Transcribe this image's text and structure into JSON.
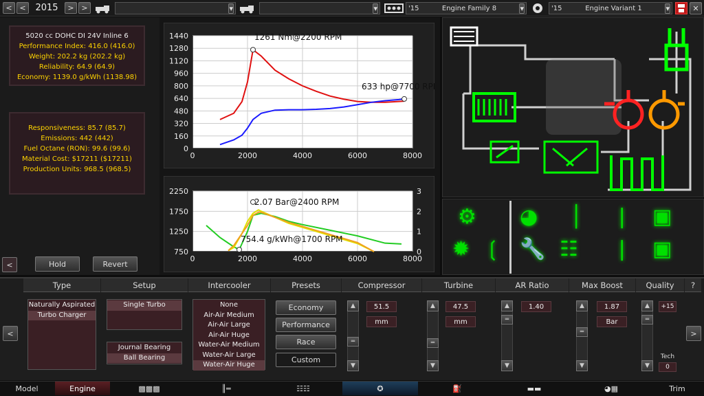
{
  "topbar": {
    "year": "2015",
    "family_year": "'15",
    "family_name": "Engine Family 8",
    "variant_year": "'15",
    "variant_name": "Engine Variant 1"
  },
  "engine_stats": {
    "name": "5020 cc DOHC DI 24V Inline 6",
    "performance": "Performance Index: 416.0 (416.0)",
    "weight": "Weight: 202.2 kg (202.2 kg)",
    "reliability": "Reliability: 64.9 (64.9)",
    "economy": "Economy: 1139.0 g/kWh (1138.98)"
  },
  "production_stats": {
    "responsiveness": "Responsiveness: 85.7 (85.7)",
    "emissions": "Emissions: 442 (442)",
    "fuel_octane": "Fuel Octane (RON): 99.6 (99.6)",
    "material_cost": "Material Cost: $17211 ($17211)",
    "production_units": "Production Units: 968.5 (968.5)"
  },
  "buttons": {
    "hold": "Hold",
    "revert": "Revert"
  },
  "chart_data": [
    {
      "type": "line",
      "x_ticks": [
        "0",
        "2000",
        "4000",
        "6000",
        "8000"
      ],
      "y_ticks": [
        "0",
        "160",
        "320",
        "480",
        "640",
        "800",
        "960",
        "1120",
        "1280",
        "1440"
      ],
      "xlim": [
        0,
        8000
      ],
      "ylim": [
        0,
        1440
      ],
      "annotations": [
        "1261 Nm@2200 RPM",
        "633 hp@7700 RPM"
      ],
      "series": [
        {
          "color": "#e01010",
          "x": [
            1000,
            1500,
            1800,
            2000,
            2200,
            2500,
            3000,
            3500,
            4000,
            4500,
            5000,
            5500,
            6000,
            6500,
            7000,
            7500,
            7700
          ],
          "y": [
            370,
            450,
            600,
            850,
            1261,
            1180,
            1000,
            890,
            800,
            730,
            670,
            630,
            600,
            590,
            590,
            600,
            605
          ]
        },
        {
          "color": "#1a1aff",
          "x": [
            1000,
            1500,
            1800,
            2000,
            2200,
            2500,
            3000,
            3500,
            4000,
            4500,
            5000,
            5500,
            6000,
            6500,
            7000,
            7500,
            7700
          ],
          "y": [
            50,
            110,
            170,
            260,
            370,
            450,
            490,
            495,
            495,
            500,
            510,
            530,
            560,
            590,
            610,
            625,
            633
          ]
        }
      ],
      "markers": [
        {
          "x": 2200,
          "y": 1261
        },
        {
          "x": 7700,
          "y": 633
        }
      ]
    },
    {
      "type": "line",
      "x_ticks": [
        "0",
        "2000",
        "4000",
        "6000",
        "8000"
      ],
      "y_ticks_left": [
        "750",
        "1250",
        "1750",
        "2250"
      ],
      "y_ticks_right": [
        "0",
        "1",
        "2",
        "3"
      ],
      "xlim": [
        0,
        8000
      ],
      "ylim": [
        750,
        2250
      ],
      "ylim_right": [
        0,
        3
      ],
      "annotations": [
        "2.07 Bar@2400 RPM",
        "754.4 g/kWh@1700 RPM"
      ],
      "series": [
        {
          "color": "#22cc22",
          "x": [
            500,
            1000,
            1500,
            1700,
            2000,
            2200,
            2500,
            3000,
            3500,
            4000,
            5000,
            6000,
            7000,
            7600
          ],
          "y": [
            1400,
            1100,
            870,
            800,
            1250,
            1650,
            1700,
            1620,
            1500,
            1420,
            1280,
            1140,
            960,
            940
          ]
        },
        {
          "color": "#e0e000",
          "x": [
            1300,
            1500,
            1800,
            2000,
            2200,
            2400,
            2500,
            3000,
            3500,
            4000,
            5000,
            6000,
            6600
          ],
          "y": [
            0.05,
            0.2,
            0.9,
            1.5,
            1.9,
            2.07,
            2.0,
            1.7,
            1.4,
            1.2,
            0.8,
            0.4,
            0.0
          ]
        },
        {
          "color": "#f0a020",
          "x": [
            1300,
            1500,
            2000,
            2200,
            2400,
            2500,
            3000,
            3500,
            4000,
            5000,
            6000,
            6600
          ],
          "y": [
            0.05,
            0.3,
            1.3,
            1.8,
            1.95,
            1.95,
            1.7,
            1.45,
            1.25,
            0.85,
            0.45,
            0.0
          ]
        }
      ],
      "markers": [
        {
          "x": 2200,
          "y": 1980
        },
        {
          "x": 1700,
          "y": 800
        }
      ]
    }
  ],
  "columns": {
    "type": "Type",
    "setup": "Setup",
    "intercooler": "Intercooler",
    "presets": "Presets",
    "compressor": "Compressor",
    "turbine": "Turbine",
    "ar_ratio": "AR Ratio",
    "max_boost": "Max Boost",
    "quality": "Quality",
    "help": "?"
  },
  "type_list": [
    "Naturally Aspirated",
    "Turbo Charger"
  ],
  "setup_list": [
    "Single Turbo"
  ],
  "bearing_list": [
    "Journal Bearing",
    "Ball Bearing"
  ],
  "intercooler_list": [
    "None",
    "Air-Air Medium",
    "Air-Air Large",
    "Air-Air Huge",
    "Water-Air Medium",
    "Water-Air Large",
    "Water-Air Huge"
  ],
  "presets": [
    "Economy",
    "Performance",
    "Race",
    "Custom"
  ],
  "compressor": {
    "value": "51.5",
    "unit": "mm"
  },
  "turbine": {
    "value": "47.5",
    "unit": "mm"
  },
  "ar_ratio": {
    "value": "1.40"
  },
  "max_boost": {
    "value": "1.87",
    "unit": "Bar"
  },
  "quality": {
    "value": "+15",
    "tech_label": "Tech",
    "tech_value": "0"
  },
  "bottom_nav": [
    "Model",
    "Engine",
    "Trim"
  ]
}
